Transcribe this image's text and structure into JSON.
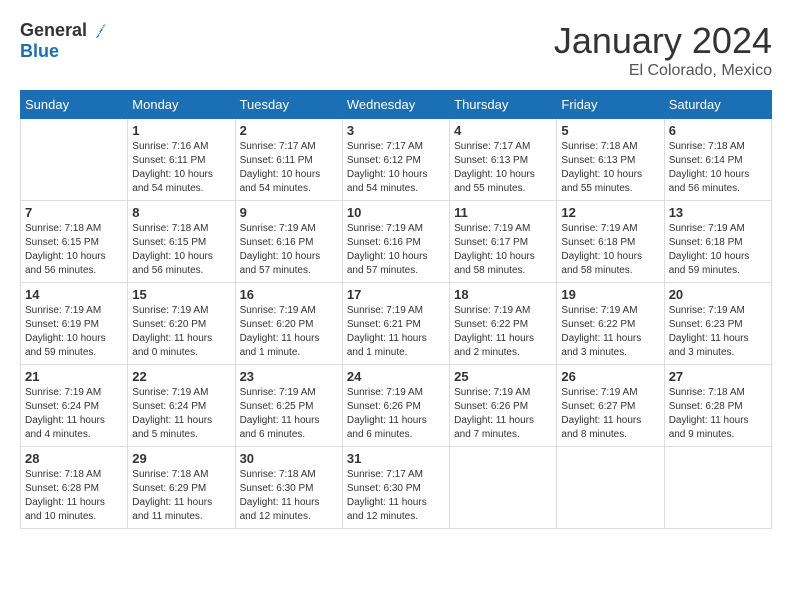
{
  "header": {
    "logo_general": "General",
    "logo_blue": "Blue",
    "month": "January 2024",
    "location": "El Colorado, Mexico"
  },
  "weekdays": [
    "Sunday",
    "Monday",
    "Tuesday",
    "Wednesday",
    "Thursday",
    "Friday",
    "Saturday"
  ],
  "weeks": [
    [
      {
        "day": "",
        "info": ""
      },
      {
        "day": "1",
        "info": "Sunrise: 7:16 AM\nSunset: 6:11 PM\nDaylight: 10 hours\nand 54 minutes."
      },
      {
        "day": "2",
        "info": "Sunrise: 7:17 AM\nSunset: 6:11 PM\nDaylight: 10 hours\nand 54 minutes."
      },
      {
        "day": "3",
        "info": "Sunrise: 7:17 AM\nSunset: 6:12 PM\nDaylight: 10 hours\nand 54 minutes."
      },
      {
        "day": "4",
        "info": "Sunrise: 7:17 AM\nSunset: 6:13 PM\nDaylight: 10 hours\nand 55 minutes."
      },
      {
        "day": "5",
        "info": "Sunrise: 7:18 AM\nSunset: 6:13 PM\nDaylight: 10 hours\nand 55 minutes."
      },
      {
        "day": "6",
        "info": "Sunrise: 7:18 AM\nSunset: 6:14 PM\nDaylight: 10 hours\nand 56 minutes."
      }
    ],
    [
      {
        "day": "7",
        "info": "Sunrise: 7:18 AM\nSunset: 6:15 PM\nDaylight: 10 hours\nand 56 minutes."
      },
      {
        "day": "8",
        "info": "Sunrise: 7:18 AM\nSunset: 6:15 PM\nDaylight: 10 hours\nand 56 minutes."
      },
      {
        "day": "9",
        "info": "Sunrise: 7:19 AM\nSunset: 6:16 PM\nDaylight: 10 hours\nand 57 minutes."
      },
      {
        "day": "10",
        "info": "Sunrise: 7:19 AM\nSunset: 6:16 PM\nDaylight: 10 hours\nand 57 minutes."
      },
      {
        "day": "11",
        "info": "Sunrise: 7:19 AM\nSunset: 6:17 PM\nDaylight: 10 hours\nand 58 minutes."
      },
      {
        "day": "12",
        "info": "Sunrise: 7:19 AM\nSunset: 6:18 PM\nDaylight: 10 hours\nand 58 minutes."
      },
      {
        "day": "13",
        "info": "Sunrise: 7:19 AM\nSunset: 6:18 PM\nDaylight: 10 hours\nand 59 minutes."
      }
    ],
    [
      {
        "day": "14",
        "info": "Sunrise: 7:19 AM\nSunset: 6:19 PM\nDaylight: 10 hours\nand 59 minutes."
      },
      {
        "day": "15",
        "info": "Sunrise: 7:19 AM\nSunset: 6:20 PM\nDaylight: 11 hours\nand 0 minutes."
      },
      {
        "day": "16",
        "info": "Sunrise: 7:19 AM\nSunset: 6:20 PM\nDaylight: 11 hours\nand 1 minute."
      },
      {
        "day": "17",
        "info": "Sunrise: 7:19 AM\nSunset: 6:21 PM\nDaylight: 11 hours\nand 1 minute."
      },
      {
        "day": "18",
        "info": "Sunrise: 7:19 AM\nSunset: 6:22 PM\nDaylight: 11 hours\nand 2 minutes."
      },
      {
        "day": "19",
        "info": "Sunrise: 7:19 AM\nSunset: 6:22 PM\nDaylight: 11 hours\nand 3 minutes."
      },
      {
        "day": "20",
        "info": "Sunrise: 7:19 AM\nSunset: 6:23 PM\nDaylight: 11 hours\nand 3 minutes."
      }
    ],
    [
      {
        "day": "21",
        "info": "Sunrise: 7:19 AM\nSunset: 6:24 PM\nDaylight: 11 hours\nand 4 minutes."
      },
      {
        "day": "22",
        "info": "Sunrise: 7:19 AM\nSunset: 6:24 PM\nDaylight: 11 hours\nand 5 minutes."
      },
      {
        "day": "23",
        "info": "Sunrise: 7:19 AM\nSunset: 6:25 PM\nDaylight: 11 hours\nand 6 minutes."
      },
      {
        "day": "24",
        "info": "Sunrise: 7:19 AM\nSunset: 6:26 PM\nDaylight: 11 hours\nand 6 minutes."
      },
      {
        "day": "25",
        "info": "Sunrise: 7:19 AM\nSunset: 6:26 PM\nDaylight: 11 hours\nand 7 minutes."
      },
      {
        "day": "26",
        "info": "Sunrise: 7:19 AM\nSunset: 6:27 PM\nDaylight: 11 hours\nand 8 minutes."
      },
      {
        "day": "27",
        "info": "Sunrise: 7:18 AM\nSunset: 6:28 PM\nDaylight: 11 hours\nand 9 minutes."
      }
    ],
    [
      {
        "day": "28",
        "info": "Sunrise: 7:18 AM\nSunset: 6:28 PM\nDaylight: 11 hours\nand 10 minutes."
      },
      {
        "day": "29",
        "info": "Sunrise: 7:18 AM\nSunset: 6:29 PM\nDaylight: 11 hours\nand 11 minutes."
      },
      {
        "day": "30",
        "info": "Sunrise: 7:18 AM\nSunset: 6:30 PM\nDaylight: 11 hours\nand 12 minutes."
      },
      {
        "day": "31",
        "info": "Sunrise: 7:17 AM\nSunset: 6:30 PM\nDaylight: 11 hours\nand 12 minutes."
      },
      {
        "day": "",
        "info": ""
      },
      {
        "day": "",
        "info": ""
      },
      {
        "day": "",
        "info": ""
      }
    ]
  ]
}
